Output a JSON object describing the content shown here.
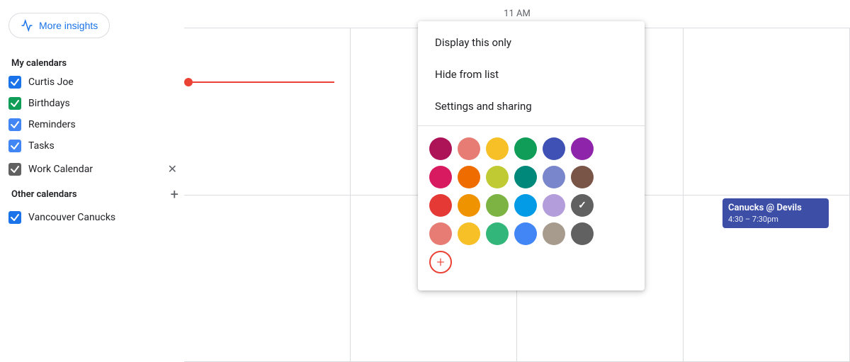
{
  "sidebar": {
    "more_insights_label": "More insights",
    "my_calendars_label": "My calendars",
    "other_calendars_label": "Other calendars",
    "calendars": [
      {
        "name": "Curtis Joe",
        "color": "#1a73e8",
        "checked": true
      },
      {
        "name": "Birthdays",
        "color": "#0f9d58",
        "checked": true
      },
      {
        "name": "Reminders",
        "color": "#4285f4",
        "checked": true
      },
      {
        "name": "Tasks",
        "color": "#4285f4",
        "checked": true
      },
      {
        "name": "Work Calendar",
        "color": "#616161",
        "checked": true,
        "has_close": true
      }
    ],
    "other_calendars": [
      {
        "name": "Vancouver Canucks",
        "color": "#1a73e8",
        "checked": true
      }
    ]
  },
  "context_menu": {
    "display_this_only": "Display this only",
    "hide_from_list": "Hide from list",
    "settings_and_sharing": "Settings and sharing"
  },
  "color_palette": {
    "rows": [
      [
        "#ad1457",
        "#e67c73",
        "#f6c026",
        "#0f9d58",
        "#3f51b5",
        "#8e24aa"
      ],
      [
        "#d81b60",
        "#ef6c00",
        "#c0ca33",
        "#00897b",
        "#7986cb",
        "#795548"
      ],
      [
        "#e53935",
        "#f09300",
        "#7cb342",
        "#039be5",
        "#b39ddb",
        "#616161"
      ],
      [
        "#e67c73",
        "#f6c026",
        "#33b679",
        "#4285f4",
        "#a79b8e",
        "#616161"
      ]
    ],
    "selected_row": 2,
    "selected_col": 5
  },
  "header": {
    "time_label": "11 AM"
  },
  "event": {
    "title": "Canucks @ Devils",
    "time": "4:30 – 7:30pm"
  }
}
